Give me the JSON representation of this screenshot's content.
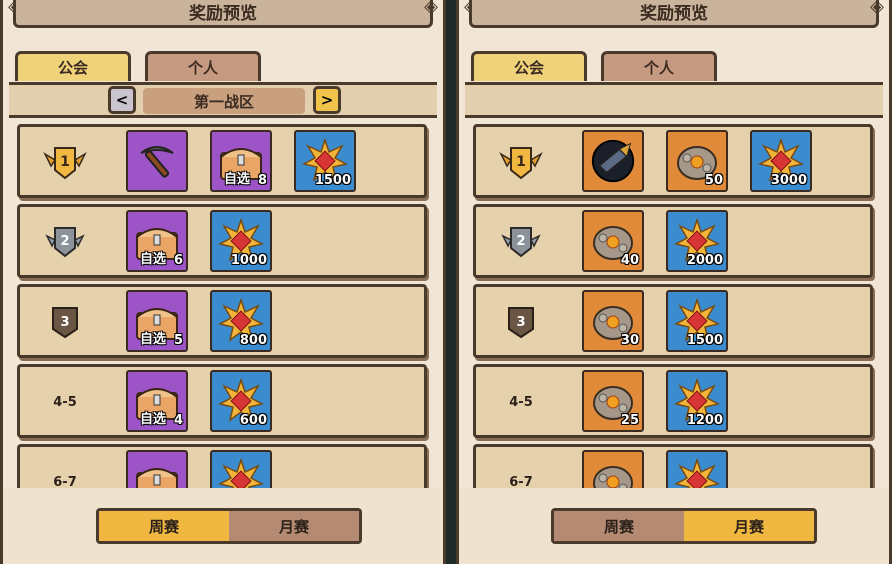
{
  "left": {
    "title": "奖励预览",
    "tabs": {
      "guild": "公会",
      "personal": "个人"
    },
    "zone_label": "第一战区",
    "rows": [
      {
        "rank": "1",
        "items": [
          {
            "color": "purple",
            "icon": "pickaxe-icon",
            "count": ""
          },
          {
            "color": "purple",
            "icon": "selectable-chest-icon",
            "count": "8",
            "select": "自选"
          },
          {
            "color": "blue",
            "icon": "sun-medal-icon",
            "count": "1500"
          }
        ]
      },
      {
        "rank": "2",
        "items": [
          {
            "color": "purple",
            "icon": "selectable-chest-icon",
            "count": "6",
            "select": "自选"
          },
          {
            "color": "blue",
            "icon": "sun-medal-icon",
            "count": "1000"
          }
        ]
      },
      {
        "rank": "3",
        "items": [
          {
            "color": "purple",
            "icon": "selectable-chest-icon",
            "count": "5",
            "select": "自选"
          },
          {
            "color": "blue",
            "icon": "sun-medal-icon",
            "count": "800"
          }
        ]
      },
      {
        "rank": "4-5",
        "items": [
          {
            "color": "purple",
            "icon": "selectable-chest-icon",
            "count": "4",
            "select": "自选"
          },
          {
            "color": "blue",
            "icon": "sun-medal-icon",
            "count": "600"
          }
        ]
      },
      {
        "rank": "6-7",
        "items": [
          {
            "color": "purple",
            "icon": "selectable-chest-icon",
            "count": ""
          },
          {
            "color": "blue",
            "icon": "sun-medal-icon",
            "count": ""
          }
        ]
      }
    ],
    "footer": {
      "weekly": "周赛",
      "monthly": "月赛",
      "active": "weekly"
    }
  },
  "right": {
    "title": "奖励预览",
    "tabs": {
      "guild": "公会",
      "personal": "个人"
    },
    "rows": [
      {
        "rank": "1",
        "items": [
          {
            "color": "orange",
            "icon": "drill-icon",
            "count": ""
          },
          {
            "color": "orange",
            "icon": "ore-rock-icon",
            "count": "50"
          },
          {
            "color": "blue",
            "icon": "sun-medal-icon",
            "count": "3000"
          }
        ]
      },
      {
        "rank": "2",
        "items": [
          {
            "color": "orange",
            "icon": "ore-rock-icon",
            "count": "40"
          },
          {
            "color": "blue",
            "icon": "sun-medal-icon",
            "count": "2000"
          }
        ]
      },
      {
        "rank": "3",
        "items": [
          {
            "color": "orange",
            "icon": "ore-rock-icon",
            "count": "30"
          },
          {
            "color": "blue",
            "icon": "sun-medal-icon",
            "count": "1500"
          }
        ]
      },
      {
        "rank": "4-5",
        "items": [
          {
            "color": "orange",
            "icon": "ore-rock-icon",
            "count": "25"
          },
          {
            "color": "blue",
            "icon": "sun-medal-icon",
            "count": "1200"
          }
        ]
      },
      {
        "rank": "6-7",
        "items": [
          {
            "color": "orange",
            "icon": "ore-rock-icon",
            "count": ""
          },
          {
            "color": "blue",
            "icon": "sun-medal-icon",
            "count": ""
          }
        ]
      }
    ],
    "footer": {
      "weekly": "周赛",
      "monthly": "月赛",
      "active": "monthly"
    }
  },
  "colors": {
    "tab_active": "#f0d27a",
    "tab_inactive": "#c69a80",
    "toggle_on": "#f0b840",
    "border": "#4a3a2c"
  }
}
